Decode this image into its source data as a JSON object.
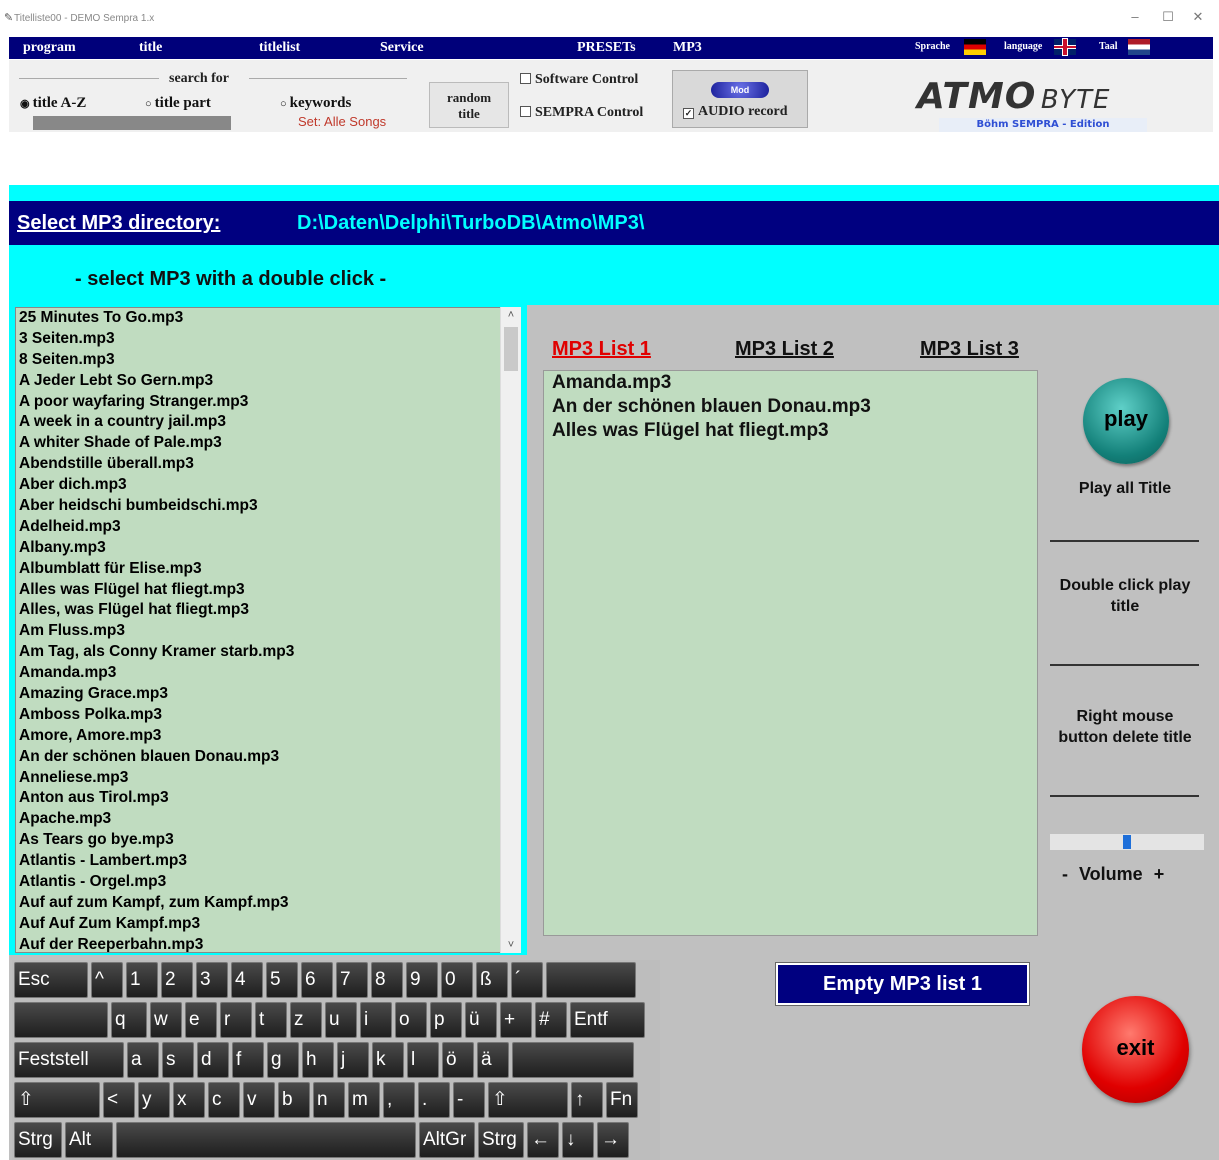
{
  "window": {
    "title": "Titelliste00 - DEMO Sempra 1.x",
    "minimize": "–",
    "maximize": "☐",
    "close": "✕"
  },
  "menu": {
    "program": "program",
    "title": "title",
    "titlelist": "titlelist",
    "service": "Service",
    "presets": "PRESETs",
    "mp3": "MP3",
    "sprache": "Sprache",
    "language": "language",
    "taal": "Taal"
  },
  "toolbar": {
    "search_for": "search for",
    "radio_title_az": "title A-Z",
    "radio_title_part": "title part",
    "radio_keywords": "keywords",
    "set_label": "Set: Alle Songs",
    "random_title": [
      "random",
      "title"
    ],
    "software_control": "Software Control",
    "sempra_control": "SEMPRA Control",
    "mod": "Mod",
    "audio_record": "AUDIO record",
    "logo_main": "ATMO",
    "logo_byte": "BYTE",
    "logo_sub": "Böhm SEMPRA - Edition"
  },
  "directory": {
    "label": "Select MP3 directory:",
    "path": "D:\\Daten\\Delphi\\TurboDB\\Atmo\\MP3\\"
  },
  "hint": "- select MP3 with a double click -",
  "files": [
    "25 Minutes To Go.mp3",
    "3 Seiten.mp3",
    "8 Seiten.mp3",
    "A Jeder Lebt So Gern.mp3",
    "A poor wayfaring Stranger.mp3",
    "A week in a country jail.mp3",
    "A whiter Shade of Pale.mp3",
    "Abendstille überall.mp3",
    "Aber dich.mp3",
    "Aber heidschi bumbeidschi.mp3",
    "Adelheid.mp3",
    "Albany.mp3",
    "Albumblatt für Elise.mp3",
    "Alles was Flügel hat fliegt.mp3",
    "Alles, was Flügel hat fliegt.mp3",
    "Am Fluss.mp3",
    "Am Tag, als Conny Kramer starb.mp3",
    "Amanda.mp3",
    "Amazing Grace.mp3",
    "Amboss Polka.mp3",
    "Amore, Amore.mp3",
    "An der schönen blauen Donau.mp3",
    "Anneliese.mp3",
    "Anton aus Tirol.mp3",
    "Apache.mp3",
    "As Tears go bye.mp3",
    "Atlantis - Lambert.mp3",
    "Atlantis - Orgel.mp3",
    "Auf auf zum Kampf, zum Kampf.mp3",
    "Auf Auf Zum Kampf.mp3",
    "Auf der Reeperbahn.mp3"
  ],
  "scroll": {
    "up": "˄",
    "down": "˅"
  },
  "tabs": [
    "MP3 List 1",
    "MP3 List 2",
    "MP3 List 3"
  ],
  "playlist": [
    "Amanda.mp3",
    "An der schönen blauen Donau.mp3",
    "Alles was Flügel hat fliegt.mp3"
  ],
  "controls": {
    "play": "play",
    "play_all": "Play all Title",
    "double_click": "Double click play title",
    "right_mouse": "Right mouse button delete title",
    "volume_minus": "-",
    "volume_label": "Volume",
    "volume_plus": "+",
    "volume_level": 0.5,
    "empty_list": "Empty MP3 list 1",
    "exit": "exit"
  },
  "keyboard": {
    "row1": [
      "Esc",
      "^",
      "1",
      "2",
      "3",
      "4",
      "5",
      "6",
      "7",
      "8",
      "9",
      "0",
      "ß",
      "´",
      ""
    ],
    "row2": [
      "",
      "q",
      "w",
      "e",
      "r",
      "t",
      "z",
      "u",
      "i",
      "o",
      "p",
      "ü",
      "+",
      "#",
      "Entf"
    ],
    "row3": [
      "Feststell",
      "a",
      "s",
      "d",
      "f",
      "g",
      "h",
      "j",
      "k",
      "l",
      "ö",
      "ä",
      ""
    ],
    "row4": [
      "⇧",
      "<",
      "y",
      "x",
      "c",
      "v",
      "b",
      "n",
      "m",
      ",",
      ".",
      "-",
      "⇧",
      "↑",
      "Fn"
    ],
    "row5": [
      "Strg",
      "Alt",
      "",
      "AltGr",
      "Strg",
      "←",
      "↓",
      "→"
    ]
  },
  "colors": {
    "menu_bg": "#00007a",
    "cyan": "#00ffff",
    "list_bg": "#c0dcc0",
    "active_tab": "#e00000",
    "play_button": "#138079",
    "exit_button": "#e00000"
  }
}
